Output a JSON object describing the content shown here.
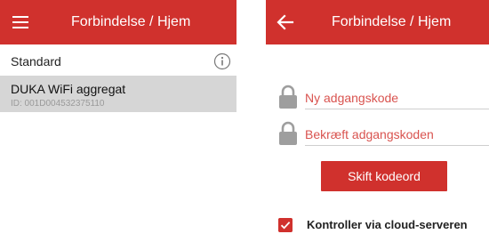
{
  "colors": {
    "accent": "#d0312d",
    "selected_row": "#d6d6d6"
  },
  "left_screen": {
    "title": "Forbindelse / Hjem",
    "menu_icon": "hamburger-icon",
    "section_label": "Standard",
    "info_icon": "info-icon",
    "device": {
      "name": "DUKA WiFi aggregat",
      "id": "ID: 001D004532375110"
    }
  },
  "right_screen": {
    "title": "Forbindelse / Hjem",
    "back_icon": "arrow-left-icon",
    "new_password_placeholder": "Ny adgangskode",
    "confirm_password_placeholder": "Bekræft adgangskoden",
    "lock_icon": "lock-icon",
    "change_button": "Skift kodeord",
    "cloud_checkbox_label": "Kontroller via cloud-serveren",
    "cloud_checked": true
  }
}
